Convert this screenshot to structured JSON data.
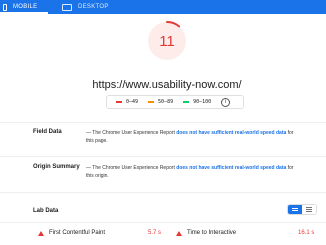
{
  "tabs": {
    "mobile": {
      "label": "MOBILE",
      "icon": "phone-icon"
    },
    "desktop": {
      "label": "DESKTOP",
      "icon": "monitor-icon"
    }
  },
  "score": {
    "value": "11",
    "fraction": 0.11,
    "color": "#e53935"
  },
  "url": "https://www.usability-now.com/",
  "legend": {
    "items": [
      {
        "range": "0–49",
        "color": "#e53935"
      },
      {
        "range": "50–89",
        "color": "#fb8c00"
      },
      {
        "range": "90–100",
        "color": "#0cce6b"
      }
    ],
    "info_icon": "info-icon"
  },
  "field_data": {
    "title": "Field Data",
    "prefix": "— The Chrome User Experience Report ",
    "link": "does not have sufficient real-world speed data",
    "suffix": " for this page."
  },
  "origin_summary": {
    "title": "Origin Summary",
    "prefix": "— The Chrome User Experience Report ",
    "link": "does not have sufficient real-world speed data",
    "suffix": " for this origin."
  },
  "lab_data": {
    "title": "Lab Data",
    "metrics": [
      {
        "label": "First Contentful Paint",
        "value": "5.7 s"
      },
      {
        "label": "Time to Interactive",
        "value": "16.1 s"
      }
    ]
  },
  "colors": {
    "accent": "#1a73e8",
    "fail": "#e53935"
  }
}
